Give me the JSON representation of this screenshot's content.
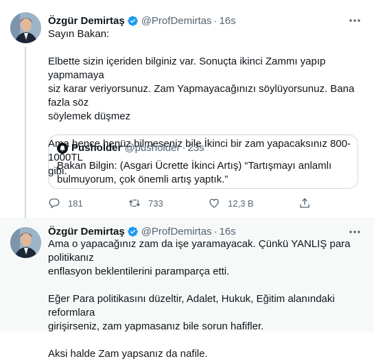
{
  "tweets": [
    {
      "name": "Özgür Demirtaş",
      "handle": "@ProfDemirtas",
      "separator": "·",
      "time": "16s",
      "lines": [
        "Sayın Bakan:",
        "",
        "Elbette sizin içeriden bilginiz var. Sonuçta ikinci Zammı yapıp yapmamaya",
        "siz karar veriyorsunuz. Zam Yapmayacağınızı söylüyorsunuz. Bana fazla söz",
        "söylemek düşmez",
        "",
        "Ama bence henüz bilmeseniz bile İkinci bir zam yapacaksınız 800-1000TL",
        "gibi."
      ],
      "quote": {
        "name": "Pusholder",
        "handle": "@pusholder",
        "separator": "·",
        "time": "23s",
        "lines": [
          "Bakan Bilgin: (Asgari Ücrette İkinci Artış) “Tartışmayı anlamlı",
          "bulmuyorum, çok önemli artış yaptık.”"
        ]
      },
      "actions": {
        "reply_count": "181",
        "retweet_count": "733",
        "like_count": "12,3 B",
        "icons": [
          "reply-icon",
          "retweet-icon",
          "like-icon",
          "share-icon"
        ]
      }
    },
    {
      "name": "Özgür Demirtaş",
      "handle": "@ProfDemirtas",
      "separator": "·",
      "time": "16s",
      "lines": [
        "Ama o yapacağınız zam da işe yaramayacak. Çünkü YANLIŞ para politikanız",
        "enflasyon beklentilerini paramparça etti.",
        "",
        "Eğer Para politikasını düzeltir, Adalet, Hukuk, Eğitim alanındaki reformlara",
        "girişirseniz, zam yapmasanız bile sorun hafifler.",
        "",
        "Aksi halde Zam yapsanız da nafile."
      ]
    }
  ],
  "colors": {
    "verified": "#1d9bf0",
    "muted_text": "#536471",
    "text": "#0f1419",
    "border": "#cfd9de",
    "selected_bg": "#f7f9f9"
  }
}
